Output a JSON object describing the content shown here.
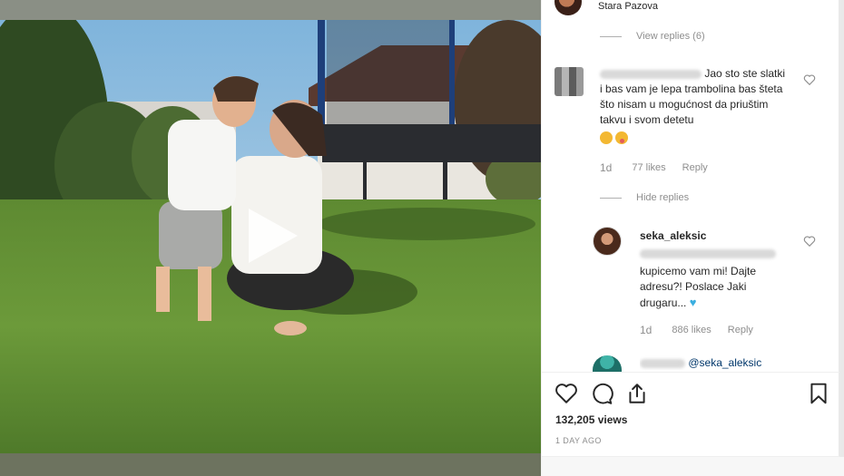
{
  "post": {
    "location": "Stara Pazova",
    "views": "132,205 views",
    "date": "1 DAY AGO"
  },
  "comments": {
    "view_replies": "View replies (6)",
    "c1": {
      "text": "Jao sto ste slatki i bas vam je lepa trambolina bas šteta što nisam u mogućnost da priuštim takvu i svom detetu",
      "age": "1d",
      "likes": "77 likes",
      "reply": "Reply"
    },
    "hide_replies": "Hide replies",
    "c2": {
      "username": "seka_aleksic",
      "text": "kupicemo vam mi! Dajte adresu?! Poslace Jaki drugaru...",
      "age": "1d",
      "likes": "886 likes",
      "reply": "Reply"
    },
    "c3": {
      "mention": "@seka_aleksic"
    }
  },
  "colors": {
    "accent_blue": "#3aaee0",
    "muted_text": "#8e8e8e",
    "text": "#262626"
  },
  "icons": [
    "heart-icon",
    "comment-icon",
    "share-icon",
    "bookmark-icon",
    "play-icon"
  ]
}
